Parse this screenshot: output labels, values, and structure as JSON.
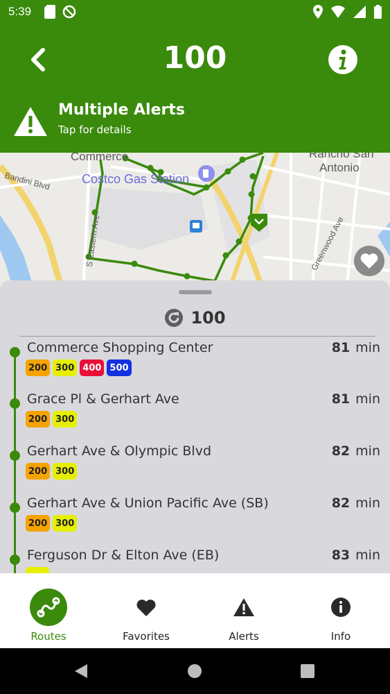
{
  "status_bar": {
    "time": "5:39",
    "icons_left": [
      "sd-card-icon",
      "no-disturb-icon"
    ],
    "icons_right": [
      "location-icon",
      "wifi-icon",
      "signal-icon",
      "battery-icon"
    ]
  },
  "header": {
    "title": "100",
    "alert_title": "Multiple Alerts",
    "alert_subtitle": "Tap for details",
    "color": "#3a8a0c"
  },
  "map": {
    "labels": {
      "commerce": "Commerce",
      "costco": "Costco Gas Station",
      "bandini": "Bandini Blvd",
      "rancho": "Rancho San",
      "antonio": "Antonio",
      "eastern": "S Eastern Ave",
      "greenwood": "Greenwood Ave"
    }
  },
  "sheet": {
    "route_title": "100",
    "stops": [
      {
        "name": "Commerce Shopping Center",
        "minutes": "81",
        "unit": "min",
        "routes": [
          {
            "label": "200",
            "bg": "#f5a300",
            "fg": "#222"
          },
          {
            "label": "300",
            "bg": "#e6ef00",
            "fg": "#222"
          },
          {
            "label": "400",
            "bg": "#e8103a",
            "fg": "#fff"
          },
          {
            "label": "500",
            "bg": "#1430e0",
            "fg": "#fff"
          }
        ]
      },
      {
        "name": "Grace Pl & Gerhart Ave",
        "minutes": "81",
        "unit": "min",
        "routes": [
          {
            "label": "200",
            "bg": "#f5a300",
            "fg": "#222"
          },
          {
            "label": "300",
            "bg": "#e6ef00",
            "fg": "#222"
          }
        ]
      },
      {
        "name": "Gerhart Ave & Olympic Blvd",
        "minutes": "82",
        "unit": "min",
        "routes": [
          {
            "label": "200",
            "bg": "#f5a300",
            "fg": "#222"
          },
          {
            "label": "300",
            "bg": "#e6ef00",
            "fg": "#222"
          }
        ]
      },
      {
        "name": "Gerhart Ave & Union Pacific Ave (SB)",
        "minutes": "82",
        "unit": "min",
        "routes": [
          {
            "label": "200",
            "bg": "#f5a300",
            "fg": "#222"
          },
          {
            "label": "300",
            "bg": "#e6ef00",
            "fg": "#222"
          }
        ]
      },
      {
        "name": "Ferguson Dr & Elton Ave (EB)",
        "minutes": "83",
        "unit": "min",
        "routes": [
          {
            "label": "",
            "bg": "#e6ef00",
            "fg": "#222"
          }
        ]
      }
    ]
  },
  "nav": {
    "items": [
      {
        "label": "Routes",
        "icon": "routes-icon",
        "active": true
      },
      {
        "label": "Favorites",
        "icon": "heart-icon",
        "active": false
      },
      {
        "label": "Alerts",
        "icon": "alert-icon",
        "active": false
      },
      {
        "label": "Info",
        "icon": "info-icon",
        "active": false
      }
    ],
    "active_color": "#3a8a0c"
  },
  "system_nav": [
    "back-icon",
    "home-icon",
    "recents-icon"
  ]
}
